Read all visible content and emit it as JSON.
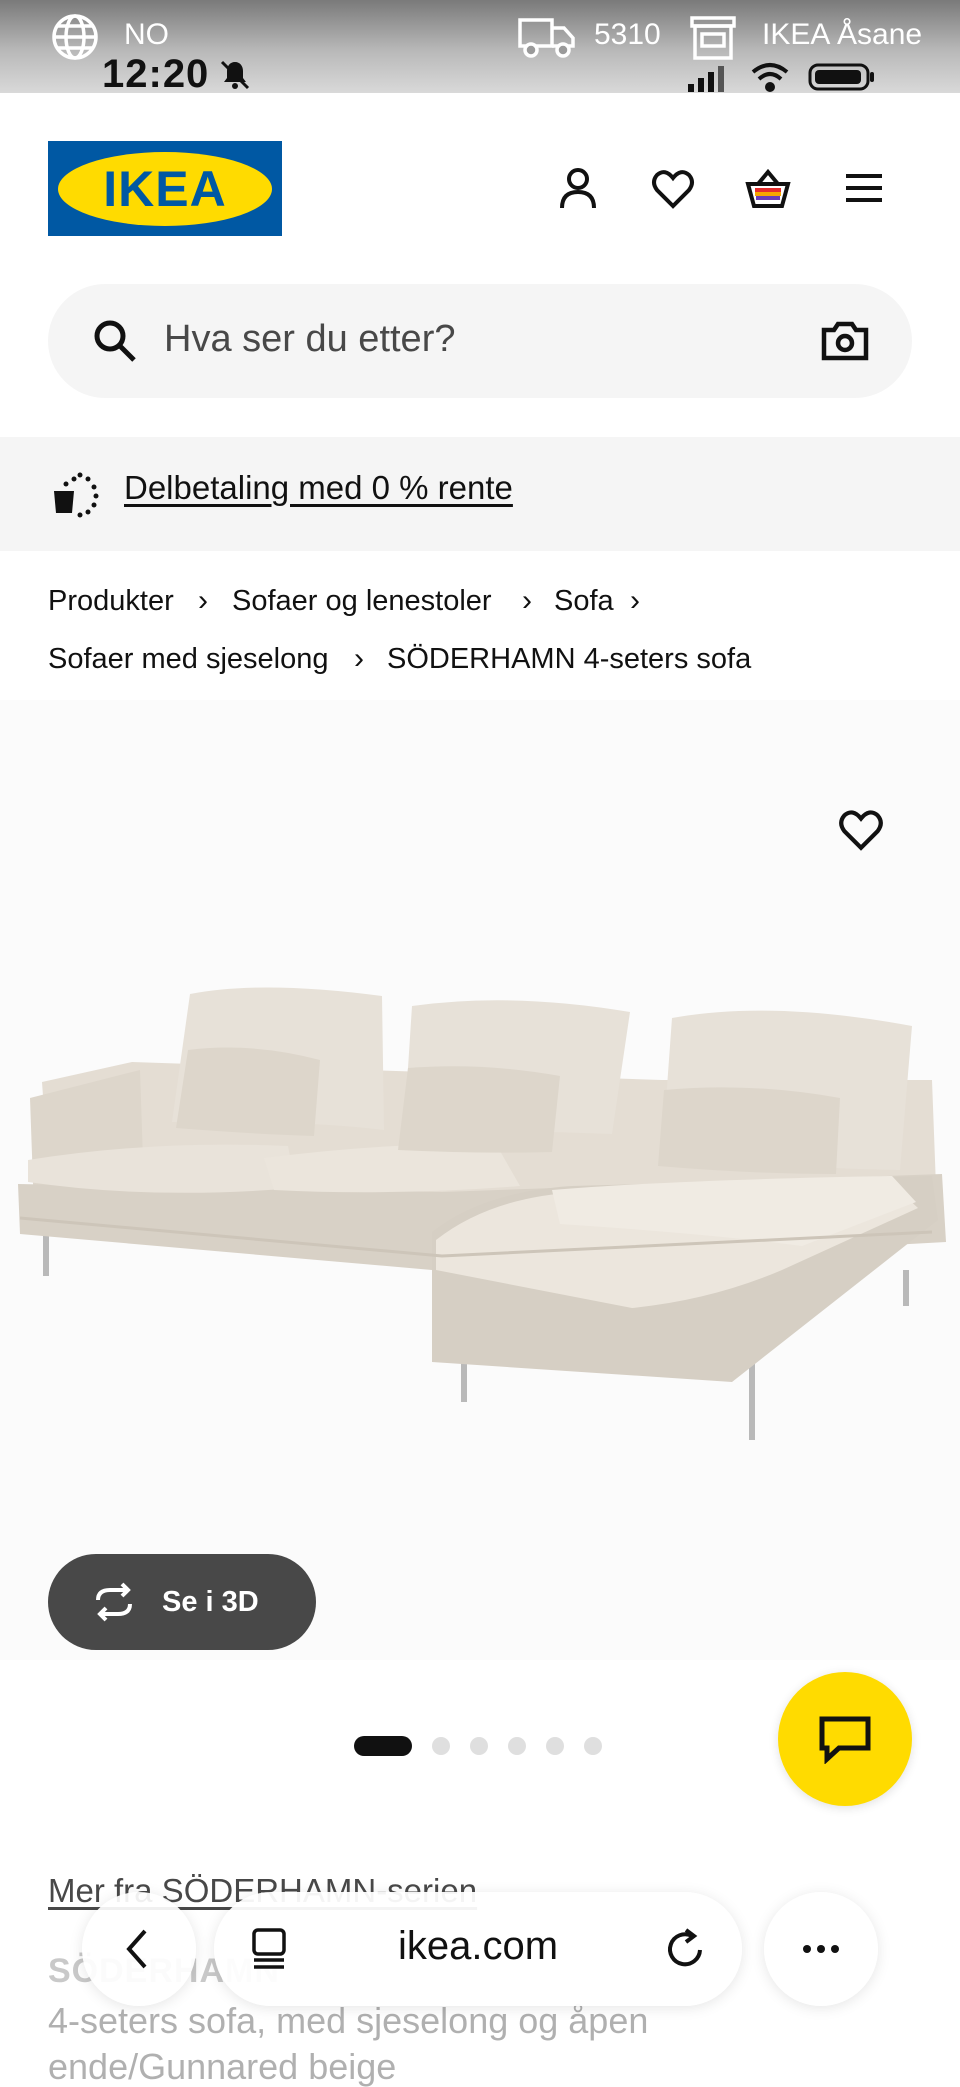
{
  "status_bar": {
    "region": "NO",
    "time": "12:20",
    "postal_code": "5310",
    "store": "IKEA Åsane"
  },
  "header": {
    "logo_text": "IKEA",
    "icons": [
      "account-icon",
      "heart-icon",
      "shopping-bag-icon",
      "hamburger-menu-icon"
    ]
  },
  "search": {
    "placeholder": "Hva ser du etter?"
  },
  "promo": {
    "link": "Delbetaling med 0 % rente"
  },
  "breadcrumb": {
    "items": [
      "Produkter",
      "Sofaer og lenestoler",
      "Sofa",
      "Sofaer med sjeselong",
      "SÖDERHAMN 4-seters sofa"
    ]
  },
  "gallery": {
    "view_3d_label": "Se i 3D",
    "image_count": 6,
    "active_index": 0
  },
  "product": {
    "series_link": "Mer fra SÖDERHAMN-serien",
    "name": "SÖDERHAMN",
    "description": "4-seters sofa, med sjeselong og åpen ende/Gunnared beige"
  },
  "browser": {
    "url": "ikea.com"
  },
  "colors": {
    "ikea_blue": "#0058a3",
    "ikea_yellow": "#ffdb00",
    "dark_button": "#484848",
    "light_bg": "#f5f5f5"
  }
}
